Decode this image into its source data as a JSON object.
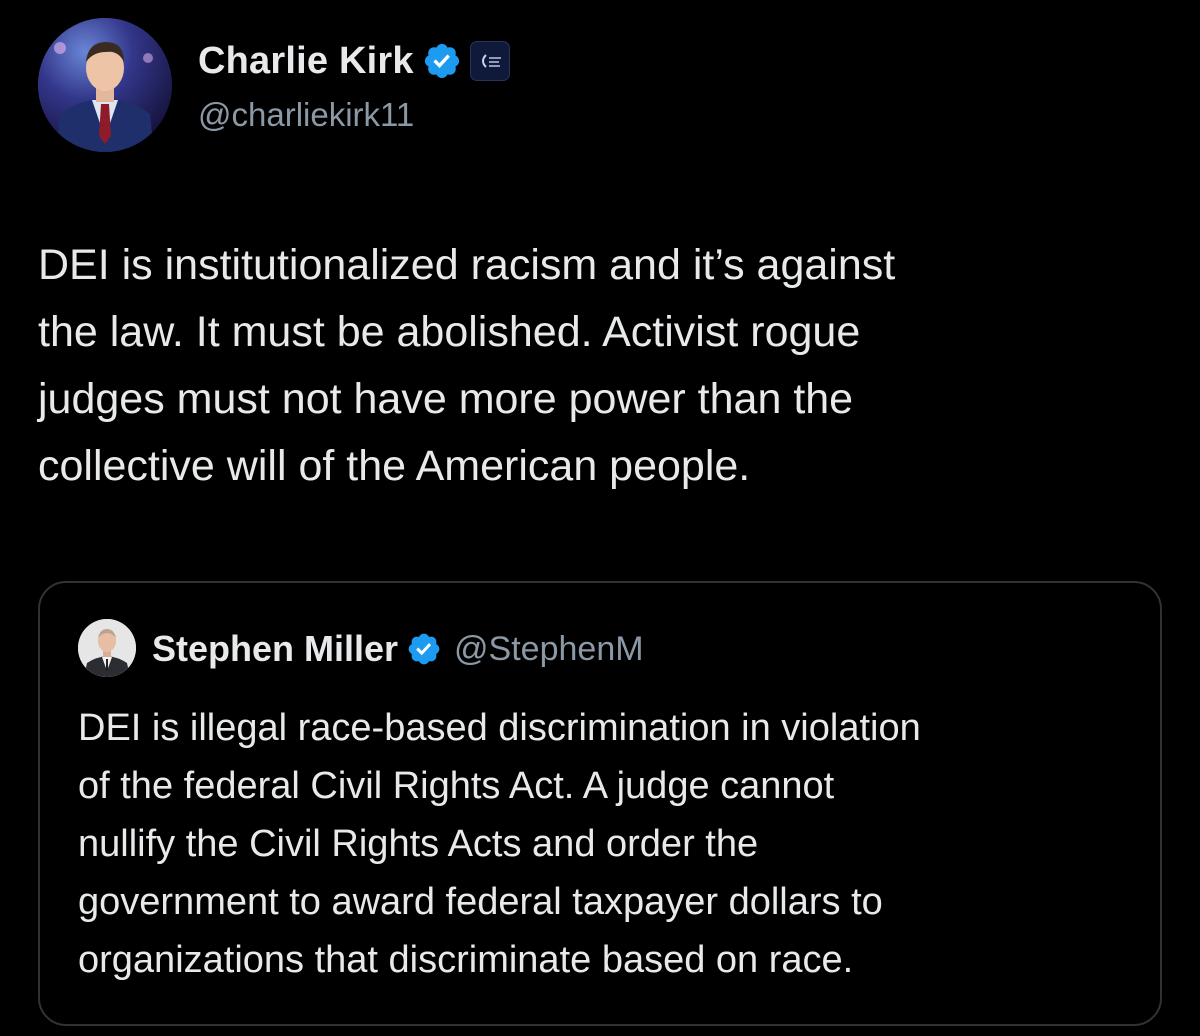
{
  "tweet": {
    "author": {
      "display_name": "Charlie Kirk",
      "handle": "@charliekirk11",
      "verified": true,
      "verified_icon": "verified-badge-icon",
      "affiliation_icon": "organization-affiliation-badge-icon"
    },
    "text": "DEI is institutionalized racism and it’s against\nthe law. It must be abolished. Activist rogue\njudges must not have more power than the\ncollective will of the American people."
  },
  "quoted_tweet": {
    "author": {
      "display_name": "Stephen Miller",
      "handle": "@StephenM",
      "verified": true,
      "verified_icon": "verified-badge-icon"
    },
    "text": "DEI is illegal race-based discrimination in violation\nof the federal Civil Rights Act. A judge cannot\nnullify the Civil Rights Acts and order the\ngovernment to award federal taxpayer dollars to\norganizations that discriminate based on race."
  },
  "colors": {
    "background": "#000000",
    "primary_text": "#e7e9ea",
    "secondary_text": "#8b98a5",
    "verified_blue": "#1d9bf0",
    "border": "#2f3336"
  }
}
